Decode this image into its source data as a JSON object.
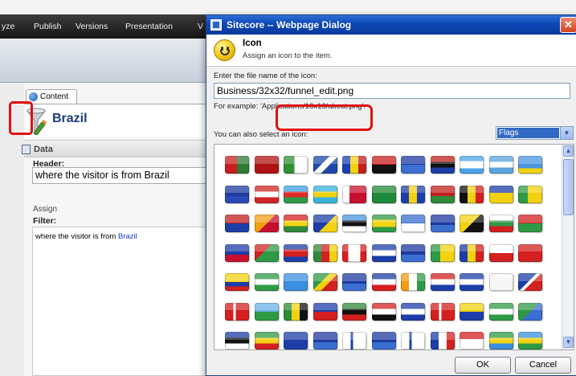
{
  "ribbon": {
    "tabs": [
      "yze",
      "Publish",
      "Versions",
      "Presentation",
      "V"
    ]
  },
  "content_editor": {
    "tab_label": "Content",
    "item_name": "Brazil",
    "section_title": "Data",
    "header_label": "Header:",
    "header_value": "where the visitor is from Brazil",
    "assign_label": "Assign",
    "filter_label": "Filter:",
    "filter_text_prefix": "where the visitor is from ",
    "filter_text_keyword": "Brazil"
  },
  "dialog": {
    "title": "Sitecore -- Webpage Dialog",
    "close_glyph": "✕",
    "heading": "Icon",
    "subheading": "Assign an icon to the item.",
    "filename_label": "Enter the file name of the icon:",
    "filename_value": "Business/32x32/funnel_edit.png",
    "example_text": "For example: 'Applications/16x16/about.png'.",
    "select_label": "You can also select an icon:",
    "category_value": "Flags",
    "ok_label": "OK",
    "cancel_label": "Cancel"
  },
  "colors": {
    "highlight": "#e01010",
    "titlebar": "#0b46b6",
    "selection": "#316ac5"
  },
  "flag_grid": {
    "icon_names": [
      "flag-icon"
    ],
    "rows": [
      [
        "linear-gradient(90deg,#c81e1e 50%,#2f7b33 50%)",
        "#b01313",
        "linear-gradient(90deg,#2f8f36 45%,#ffffff 45%)",
        "linear-gradient(135deg,#1d4aa8 40%,#ffffff 40%,#ffffff 60%,#1d4aa8 60%)",
        "linear-gradient(90deg,#1c3fb0 33%,#f2d210 33%,#f2d210 66%,#c21f1f 66%)",
        "linear-gradient(180deg,#c81e1e 50%,#111 50%)",
        "linear-gradient(180deg,#1e3aa0 50%,#3b6fd0 50%)",
        "linear-gradient(180deg,#c21f1f 35%,#111 35%,#111 65%,#1d3ea8 65%)",
        "linear-gradient(180deg,#4aa3e8 30%,#ffffff 30%,#ffffff 70%,#4aa3e8 70%)",
        "linear-gradient(180deg,#5aa4e0 33%,#ffffff 33%,#ffffff 66%,#5aa4e0 66%)",
        "linear-gradient(180deg,#4a96e0 70%,#f2d210 70%)"
      ],
      [
        "linear-gradient(180deg,#1e3aa0 60%,#2b4ab8 60%)",
        "linear-gradient(180deg,#d02525 33%,#ffffff 33%,#ffffff 66%,#d02525 66%)",
        "linear-gradient(180deg,#3aa3e0 33%,#e02b2b 33%,#e02b2b 66%,#2f9a45 66%)",
        "linear-gradient(180deg,#39b3d8 33%,#f2d210 33%,#f2d210 66%,#39b3d8 66%)",
        "linear-gradient(90deg,#ffffff 30%,#c8102e 30%)",
        "#1f8a3a",
        "linear-gradient(90deg,#1d3ea8 33%,#f2d210 33%,#f2d210 66%,#1d3ea8 66%)",
        "linear-gradient(180deg,#c21f1f 60%,#2f8a3a 60%)",
        "linear-gradient(90deg,#111 33%,#f2d210 33%,#f2d210 66%,#d42020 66%)",
        "linear-gradient(180deg,#1d3ea8 40%,#f2d210 40%)",
        "linear-gradient(90deg,#2f9a45 40%,#f2d210 40%)"
      ],
      [
        "linear-gradient(180deg,#c21f1f 50%,#1d3ea8 50%)",
        "linear-gradient(135deg,#f2a010 50%,#c8102e 50%)",
        "linear-gradient(180deg,#d42020 33%,#f2d210 33%,#f2d210 66%,#2f8a3a 66%)",
        "linear-gradient(135deg,#1d3ea8 55%,#f2d210 55%)",
        "linear-gradient(180deg,#4a96e0 33%,#111 33%,#111 66%,#ffffff 66%)",
        "linear-gradient(180deg,#2f9a45 30%,#f2d210 30%,#f2d210 70%,#2f9a45 70%)",
        "linear-gradient(180deg,#3a6ed0 50%,#ffffff 50%)",
        "linear-gradient(180deg,#1e3aa0 60%,#3b6fd0 60%)",
        "linear-gradient(135deg,#f2d210 50%,#111 50%)",
        "linear-gradient(180deg,#ffffff 33%,#2f9a45 33%,#2f9a45 66%,#d42020 66%)",
        "linear-gradient(180deg,#d42020 50%,#2f9a45 50%)"
      ],
      [
        "linear-gradient(180deg,#1d3ea8 60%,#c8102e 60%)",
        "linear-gradient(135deg,#d42020 40%,#2f9a45 40%)",
        "linear-gradient(180deg,#1d3ea8 30%,#d42020 30%,#d42020 70%,#1d3ea8 70%)",
        "linear-gradient(90deg,#2f8a3a 33%,#d42020 33%,#d42020 66%,#f2d210 66%)",
        "linear-gradient(90deg,#d42020 25%,#ffffff 25%,#ffffff 75%,#d42020 75%)",
        "linear-gradient(180deg,#1d3ea8 33%,#ffffff 33%,#ffffff 66%,#1d3ea8 66%)",
        "linear-gradient(180deg,#1e3aa0 60%,#3b6fd0 60%)",
        "linear-gradient(90deg,#2f9a45 40%,#f2d210 40%)",
        "linear-gradient(90deg,#1d3ea8 33%,#f2d210 33%,#f2d210 66%,#d42020 66%)",
        "linear-gradient(180deg,#ffffff 50%,#d42020 50%)",
        "#d42020"
      ],
      [
        "linear-gradient(180deg,#f2d210 50%,#1d3ea8 50%,#1d3ea8 75%,#d42020 75%)",
        "linear-gradient(180deg,#2f9a45 33%,#ffffff 33%,#ffffff 66%,#2f9a45 66%)",
        "#3a8fe0",
        "linear-gradient(135deg,#2f9a45 40%,#f2d210 40%,#f2d210 60%,#d42020 60%)",
        "linear-gradient(180deg,#1e3aa0 60%,#3b6fd0 60%)",
        "linear-gradient(180deg,#1d3ea8 33%,#ffffff 33%,#ffffff 66%,#d42020 66%)",
        "linear-gradient(90deg,#f29a10 33%,#ffffff 33%,#ffffff 66%,#2f9a45 66%)",
        "linear-gradient(180deg,#d42020 33%,#ffffff 33%,#ffffff 66%,#1d3ea8 66%)",
        "linear-gradient(180deg,#1d3ea8 33%,#ffffff 33%,#ffffff 66%,#1d3ea8 66%)",
        "#f6f6f6",
        "linear-gradient(135deg,#1d3ea8 45%,#ffffff 45%,#ffffff 55%,#d42020 55%)"
      ],
      [
        "linear-gradient(90deg,#d42020 35%,#ffffff 35%,#ffffff 45%,#d42020 45%)",
        "linear-gradient(180deg,#6ab0e8 50%,#2f9a45 50%)",
        "linear-gradient(90deg,#2f8a3a 33%,#f2d210 33%,#f2d210 66%,#111 66%)",
        "linear-gradient(180deg,#1d3ea8 50%,#d42020 50%)",
        "linear-gradient(180deg,#2f8a3a 35%,#111 35%,#111 65%,#d42020 65%)",
        "linear-gradient(180deg,#d42020 33%,#ffffff 33%,#ffffff 66%,#111 66%)",
        "linear-gradient(180deg,#1d3ea8 33%,#ffffff 33%,#ffffff 66%,#1d3ea8 66%)",
        "linear-gradient(90deg,#d42020 35%,#ffffff 35%,#ffffff 45%,#d42020 45%)",
        "linear-gradient(180deg,#f2d210 50%,#1d3ea8 50%)",
        "linear-gradient(180deg,#2f9a45 33%,#ffffff 33%,#ffffff 66%,#2f9a45 66%)",
        "linear-gradient(135deg,#2f9a45 50%,#3a6ed0 50%)"
      ],
      [
        "linear-gradient(180deg,#1d3ea8 33%,#111 33%,#111 66%,#ffffff 66%)",
        "linear-gradient(180deg,#2f9a45 33%,#f2d210 33%,#f2d210 66%,#d42020 66%)",
        "#1d3ea8",
        "linear-gradient(180deg,#1e3aa0 60%,#3b6fd0 60%)",
        "linear-gradient(90deg,#ffffff 35%,#1d3ea8 35%,#1d3ea8 45%,#ffffff 45%)",
        "linear-gradient(180deg,#1e3aa0 60%,#3b6fd0 60%)",
        "linear-gradient(90deg,#ffffff 35%,#1d3ea8 35%,#1d3ea8 45%,#ffffff 45%)",
        "linear-gradient(90deg,#1d3ea8 33%,#ffffff 33%,#ffffff 66%,#d42020 66%)",
        "linear-gradient(180deg,#d42020 40%,#ffffff 40%)",
        "linear-gradient(180deg,#2f9a45 33%,#f2d210 33%,#f2d210 66%,#3a8fe0 66%)",
        "linear-gradient(180deg,#3a8fe0 33%,#f2d210 33%,#f2d210 66%,#2f9a45 66%)"
      ]
    ]
  }
}
